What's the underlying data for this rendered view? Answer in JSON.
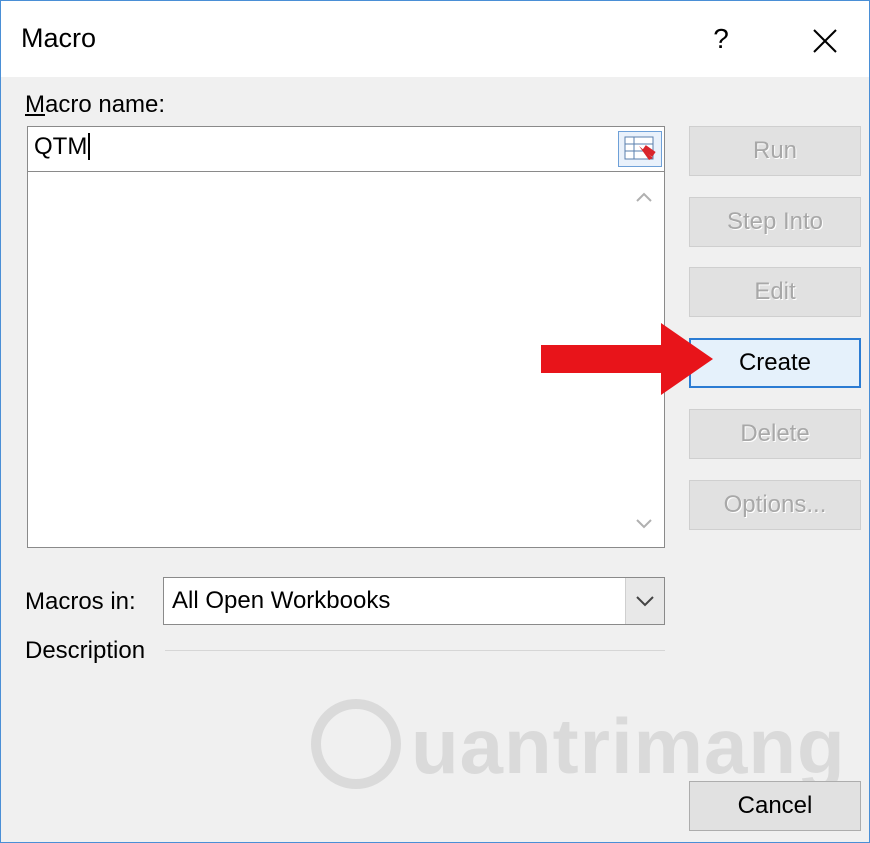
{
  "window": {
    "title": "Macro",
    "help_label": "?",
    "close_icon": "close-icon"
  },
  "macro_name": {
    "label": "Macro name:",
    "value": "QTM",
    "picker_icon": "range-picker-icon"
  },
  "macro_list": {
    "items": [],
    "scroll_up_icon": "chevron-up-icon",
    "scroll_down_icon": "chevron-down-icon"
  },
  "buttons": {
    "run": "Run",
    "step_into": "Step Into",
    "edit": "Edit",
    "create": "Create",
    "delete": "Delete",
    "options": "Options...",
    "cancel": "Cancel"
  },
  "macros_in": {
    "label": "Macros in:",
    "selected": "All Open Workbooks",
    "dropdown_icon": "chevron-down-icon"
  },
  "description": {
    "label": "Description"
  },
  "annotation": {
    "arrow_color": "#e8141a",
    "arrow_icon": "red-arrow-icon"
  },
  "watermark": {
    "text": "uantrimang"
  },
  "colors": {
    "accent": "#2b7cd3",
    "dialog_border": "#4a8fd6",
    "disabled_text": "#a8a8a8"
  }
}
